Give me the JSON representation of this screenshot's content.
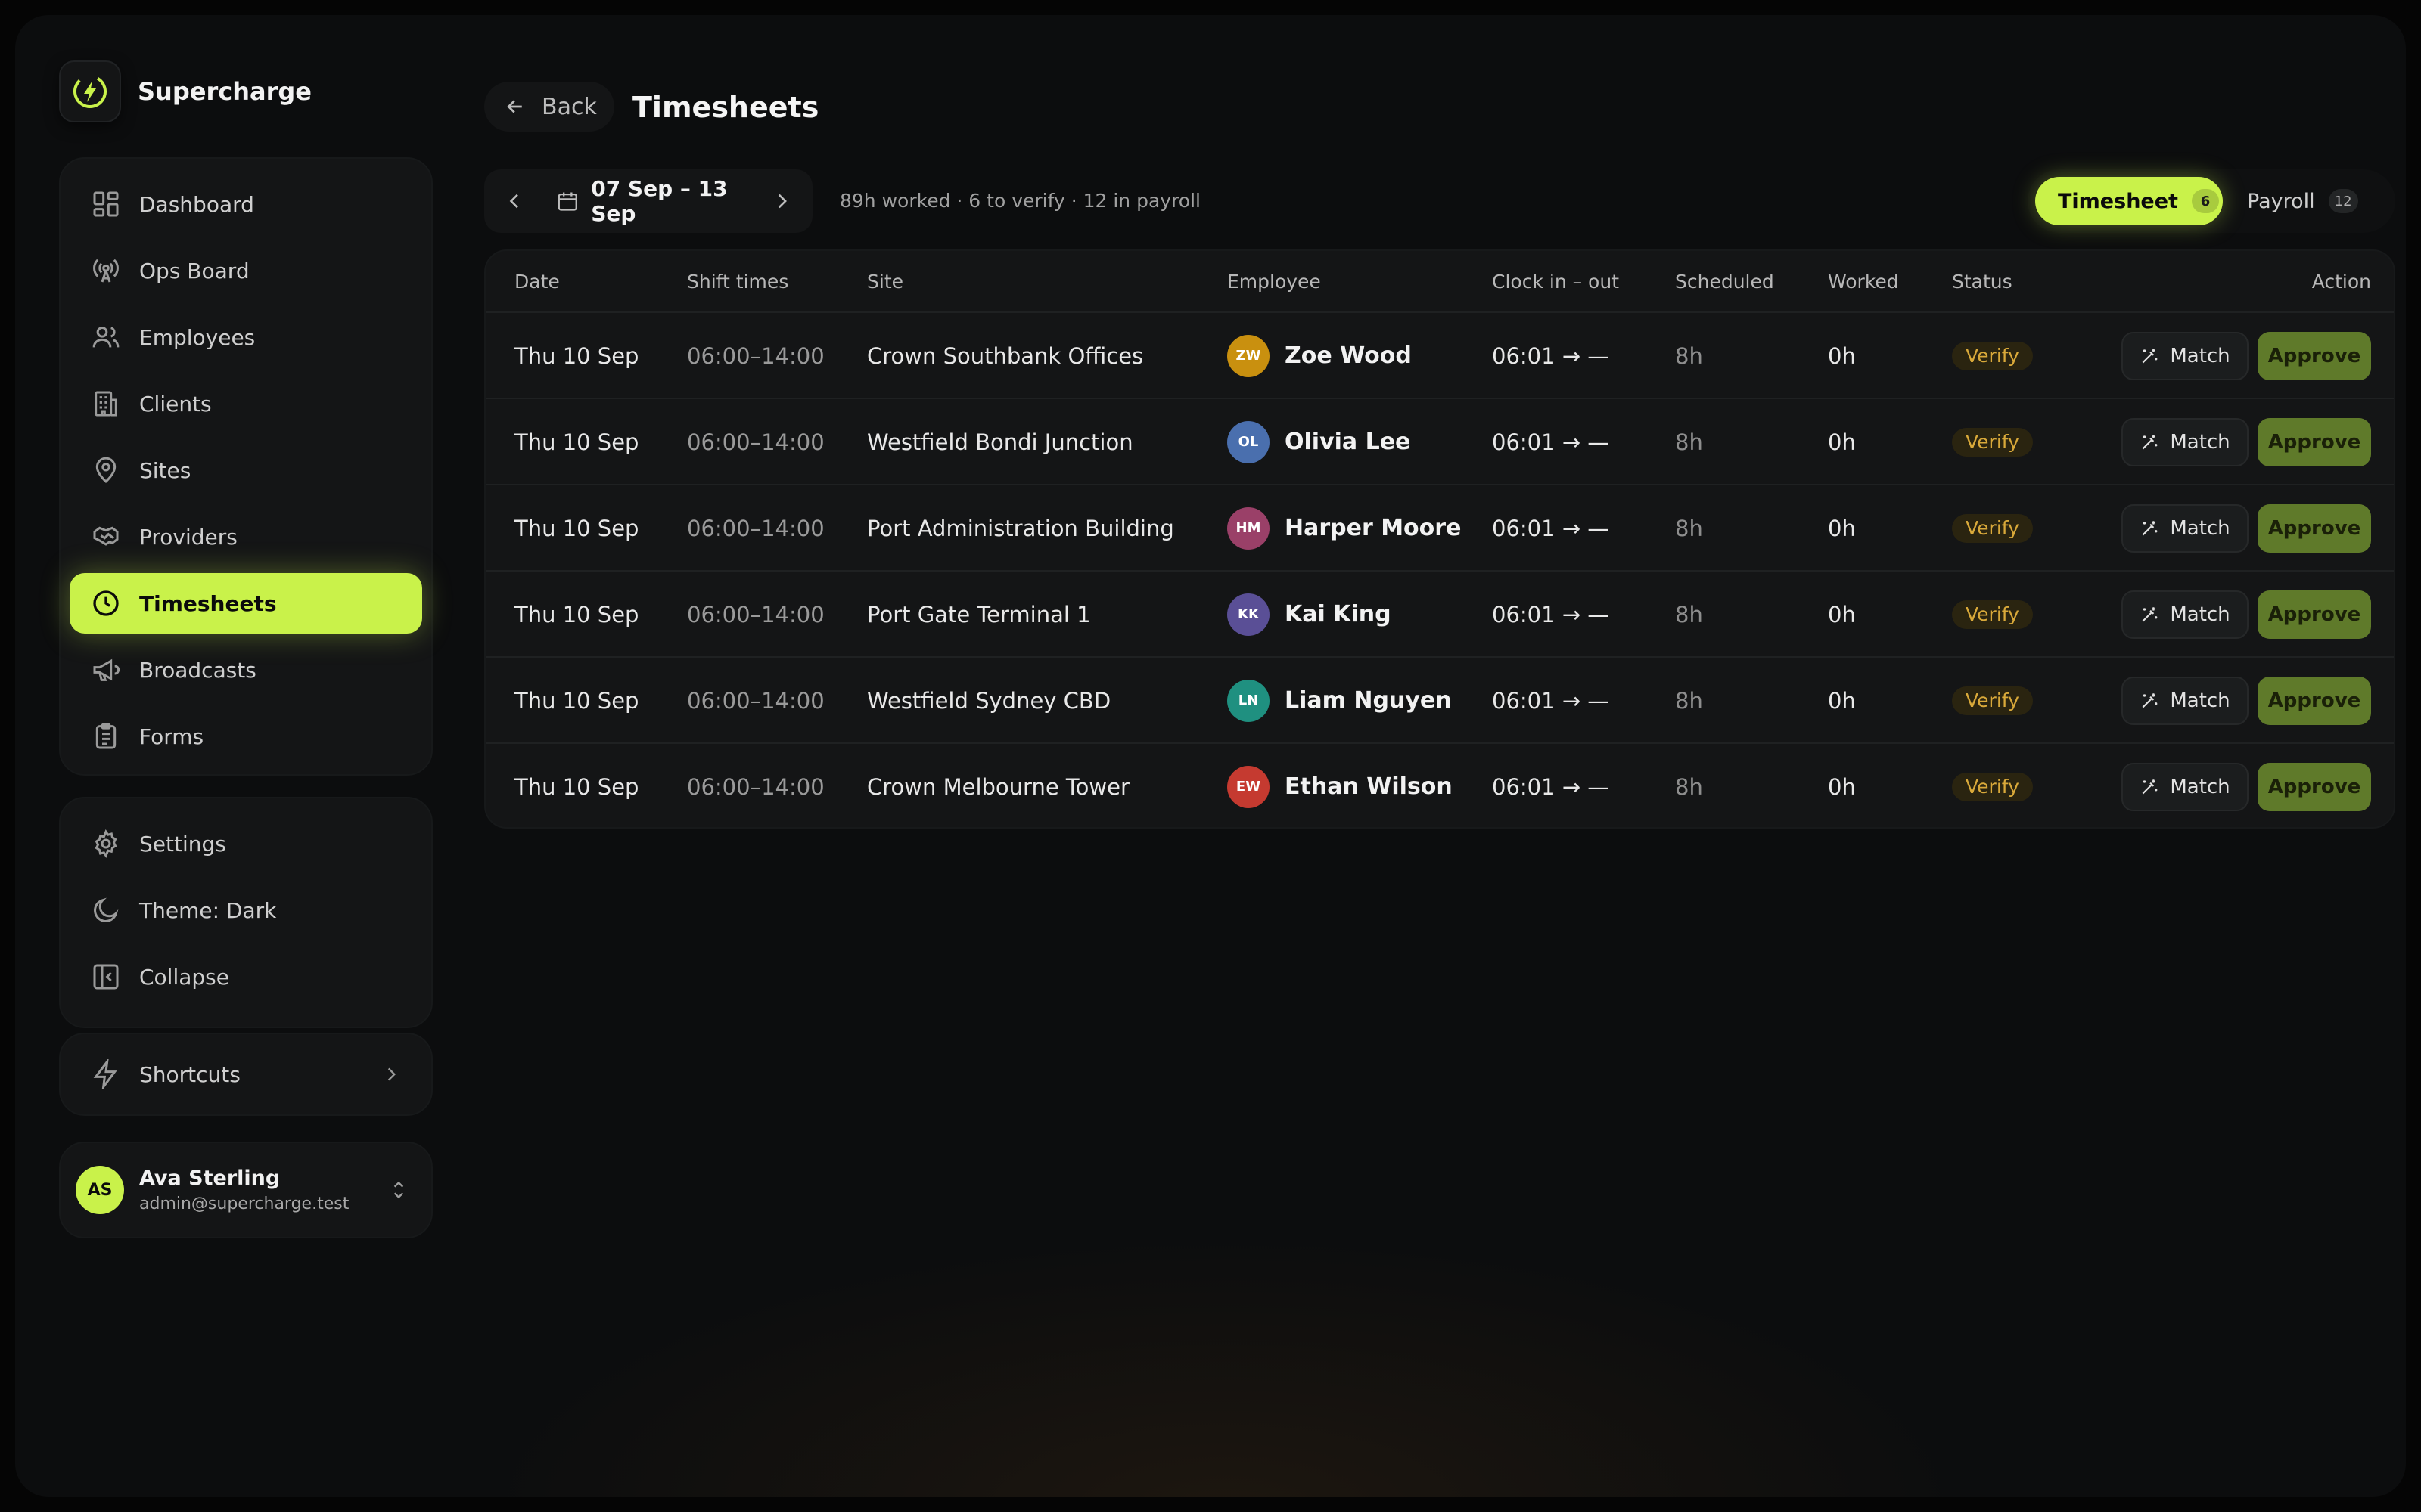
{
  "brand": {
    "name": "Supercharge"
  },
  "nav": {
    "main": [
      {
        "label": "Dashboard",
        "icon": "grid-icon"
      },
      {
        "label": "Ops Board",
        "icon": "broadcast-icon"
      },
      {
        "label": "Employees",
        "icon": "users-icon"
      },
      {
        "label": "Clients",
        "icon": "building-icon"
      },
      {
        "label": "Sites",
        "icon": "map-pin-icon"
      },
      {
        "label": "Providers",
        "icon": "handshake-icon"
      },
      {
        "label": "Timesheets",
        "icon": "clock-icon",
        "active": true
      },
      {
        "label": "Broadcasts",
        "icon": "megaphone-icon"
      },
      {
        "label": "Forms",
        "icon": "clipboard-icon"
      }
    ],
    "system": [
      {
        "label": "Settings",
        "icon": "gear-icon"
      },
      {
        "label": "Theme: Dark",
        "icon": "moon-icon"
      },
      {
        "label": "Collapse",
        "icon": "sidebar-collapse-icon"
      }
    ],
    "shortcuts": {
      "label": "Shortcuts",
      "icon": "lightning-icon"
    }
  },
  "user": {
    "initials": "AS",
    "name": "Ava Sterling",
    "email": "admin@supercharge.test"
  },
  "header": {
    "back_label": "Back",
    "title": "Timesheets"
  },
  "week": {
    "range": "07 Sep – 13 Sep",
    "summary": "89h worked · 6 to verify · 12 in payroll"
  },
  "tabs": [
    {
      "label": "Timesheet",
      "count": "6",
      "active": true
    },
    {
      "label": "Payroll",
      "count": "12",
      "active": false
    }
  ],
  "table": {
    "columns": [
      "Date",
      "Shift times",
      "Site",
      "Employee",
      "Clock in – out",
      "Scheduled",
      "Worked",
      "Status",
      "Action"
    ],
    "rows": [
      {
        "date": "Thu 10 Sep",
        "shift": "06:00–14:00",
        "site": "Crown Southbank Offices",
        "initials": "ZW",
        "employee": "Zoe Wood",
        "avatar_color": "#c9900f",
        "clock": "06:01 → —",
        "scheduled": "8h",
        "worked": "0h",
        "status": "Verify",
        "match": "Match",
        "approve": "Approve"
      },
      {
        "date": "Thu 10 Sep",
        "shift": "06:00–14:00",
        "site": "Westfield Bondi Junction",
        "initials": "OL",
        "employee": "Olivia Lee",
        "avatar_color": "#4a6fae",
        "clock": "06:01 → —",
        "scheduled": "8h",
        "worked": "0h",
        "status": "Verify",
        "match": "Match",
        "approve": "Approve"
      },
      {
        "date": "Thu 10 Sep",
        "shift": "06:00–14:00",
        "site": "Port Administration Building",
        "initials": "HM",
        "employee": "Harper Moore",
        "avatar_color": "#9a4068",
        "clock": "06:01 → —",
        "scheduled": "8h",
        "worked": "0h",
        "status": "Verify",
        "match": "Match",
        "approve": "Approve"
      },
      {
        "date": "Thu 10 Sep",
        "shift": "06:00–14:00",
        "site": "Port Gate Terminal 1",
        "initials": "KK",
        "employee": "Kai King",
        "avatar_color": "#5a4f96",
        "clock": "06:01 → —",
        "scheduled": "8h",
        "worked": "0h",
        "status": "Verify",
        "match": "Match",
        "approve": "Approve"
      },
      {
        "date": "Thu 10 Sep",
        "shift": "06:00–14:00",
        "site": "Westfield Sydney CBD",
        "initials": "LN",
        "employee": "Liam Nguyen",
        "avatar_color": "#1f9080",
        "clock": "06:01 → —",
        "scheduled": "8h",
        "worked": "0h",
        "status": "Verify",
        "match": "Match",
        "approve": "Approve"
      },
      {
        "date": "Thu 10 Sep",
        "shift": "06:00–14:00",
        "site": "Crown Melbourne Tower",
        "initials": "EW",
        "employee": "Ethan Wilson",
        "avatar_color": "#c53a30",
        "clock": "06:01 → —",
        "scheduled": "8h",
        "worked": "0h",
        "status": "Verify",
        "match": "Match",
        "approve": "Approve"
      }
    ]
  },
  "colors": {
    "accent": "#c9f24a",
    "approve": "#5f7a2a",
    "verify": "#d9a93a",
    "background": "#0c0d0e"
  }
}
